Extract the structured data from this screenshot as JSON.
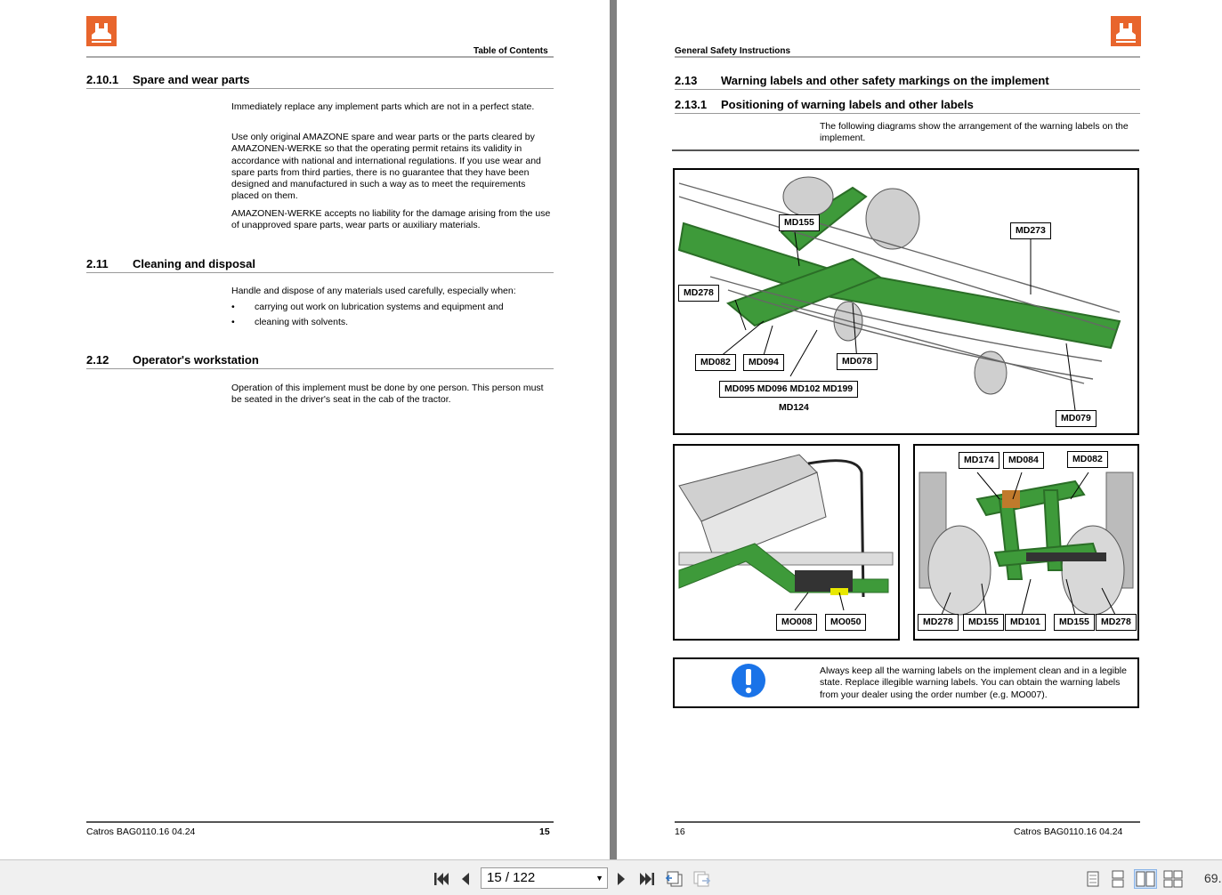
{
  "left_page": {
    "header_title": "Table of Contents",
    "sections": [
      {
        "number": "2.10.1",
        "title": "Spare and wear parts"
      },
      {
        "number": "2.11",
        "title": "Cleaning and disposal"
      },
      {
        "number": "2.12",
        "title": "Operator's workstation"
      }
    ],
    "paragraphs": [
      "Immediately replace any implement parts which are not in a perfect state.",
      "Use only original AMAZONE spare and wear parts or the parts cleared by AMAZONEN-WERKE so that the operating permit retains its validity in accordance with national and international regulations. If you use wear and spare parts from third parties, there is no guarantee that they have been designed and manufactured in such a way as to meet the requirements placed on them.",
      "AMAZONEN-WERKE accepts no liability for the damage arising from the use of unapproved spare parts, wear parts or auxiliary materials.",
      "Handle and dispose of any materials used carefully, especially when:",
      "Operation of this implement must be done by one person. This person must be seated in the driver's seat in the cab of the tractor."
    ],
    "bullets": [
      "carrying out work on lubrication systems and equipment and",
      "cleaning with solvents."
    ],
    "footer_left": "Catros  BAG0110.16  04.24",
    "footer_page": "15"
  },
  "right_page": {
    "header_title": "General Safety Instructions",
    "sections": [
      {
        "number": "2.13",
        "title": "Warning labels and other safety markings on the implement"
      },
      {
        "number": "2.13.1",
        "title": "Positioning of warning labels and other labels"
      }
    ],
    "intro": "The following diagrams show the arrangement of the warning labels on the implement.",
    "fig1_labels": [
      "MD155",
      "MD273",
      "MD278",
      "MD082",
      "MD094",
      "MD078",
      "MD095 MD096 MD102 MD199",
      "MD124",
      "MD079"
    ],
    "fig2_labels": [
      "MO008",
      "MO050"
    ],
    "fig3_labels": [
      "MD174",
      "MD084",
      "MD082",
      "MD278",
      "MD155",
      "MD101",
      "MD155",
      "MD278"
    ],
    "note_text": "Always keep all the warning labels on the implement clean and in a legible state. Replace illegible warning labels. You can obtain the warning labels from your dealer using the order number (e.g. MO007).",
    "footer_page": "16",
    "footer_right": "Catros  BAG0110.16  04.24"
  },
  "toolbar": {
    "page_indicator": "15 / 122",
    "zoom": "69."
  },
  "colors": {
    "logo": "#e8652c",
    "implement_green": "#3e9a3a",
    "info_blue": "#1a73e8"
  }
}
